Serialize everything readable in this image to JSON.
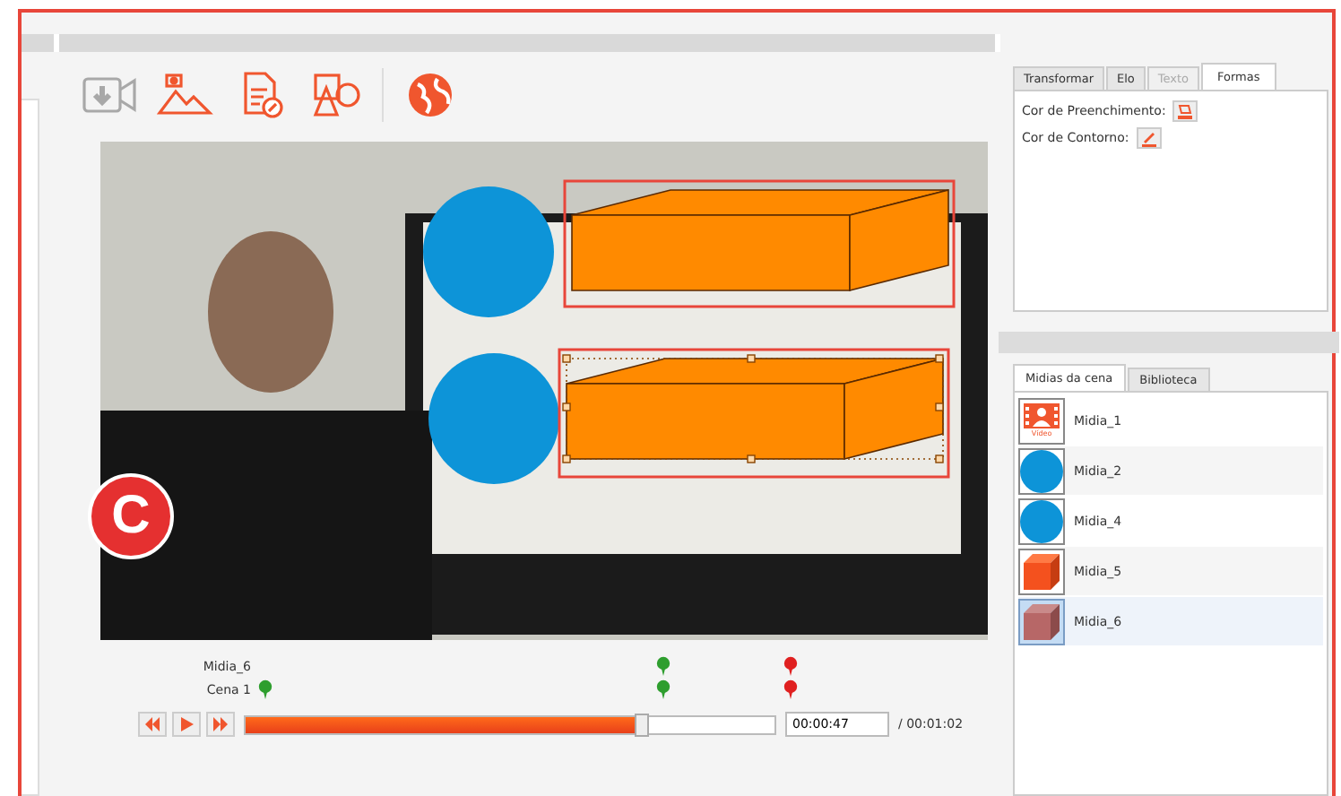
{
  "badge": {
    "text": "C"
  },
  "toolbar": [
    {
      "kind": "video",
      "disabled": true
    },
    {
      "kind": "image",
      "disabled": false
    },
    {
      "kind": "document",
      "disabled": false
    },
    {
      "kind": "shapes",
      "disabled": false
    },
    {
      "kind": "globe",
      "disabled": false
    }
  ],
  "scene": {
    "shapes": [
      {
        "kind": "circle",
        "selected": false
      },
      {
        "kind": "box",
        "selected": false
      },
      {
        "kind": "circle",
        "selected": false
      },
      {
        "kind": "box",
        "selected": true
      }
    ]
  },
  "timeline": {
    "tracks": [
      {
        "label": "Midia_6",
        "markers": [
          {
            "kind": "current",
            "color": "#2e9e2e"
          },
          {
            "kind": "end",
            "color": "#e02020"
          }
        ]
      },
      {
        "label": "Cena 1",
        "markers": [
          {
            "kind": "start",
            "color": "#2e9e2e"
          },
          {
            "kind": "current",
            "color": "#2e9e2e"
          },
          {
            "kind": "end",
            "color": "#e02020"
          }
        ]
      }
    ],
    "controls": [
      {
        "kind": "rewind"
      },
      {
        "kind": "play"
      },
      {
        "kind": "forward"
      }
    ],
    "level": 0.75,
    "time": "00:00:47",
    "total": "/ 00:01:02"
  },
  "properties": {
    "tabs": [
      {
        "label": "Transformar",
        "selected": false,
        "disabled": false
      },
      {
        "label": "Elo",
        "selected": false,
        "disabled": false
      },
      {
        "label": "Texto",
        "selected": false,
        "disabled": true
      },
      {
        "label": "Formas",
        "selected": true,
        "disabled": false
      }
    ],
    "fields": [
      {
        "label": "Cor de Preenchimento:",
        "kind": "fill"
      },
      {
        "label": "Cor de Contorno:",
        "kind": "stroke"
      }
    ]
  },
  "media": {
    "tabs": [
      {
        "label": "Midias da cena",
        "selected": true
      },
      {
        "label": "Biblioteca",
        "selected": false
      }
    ],
    "items": [
      {
        "name": "Midia_1",
        "kind": "video",
        "thumb_label": "Vídeo",
        "selected": false
      },
      {
        "name": "Midia_2",
        "kind": "circle",
        "selected": false
      },
      {
        "name": "Midia_4",
        "kind": "circle",
        "selected": false
      },
      {
        "name": "Midia_5",
        "kind": "cube",
        "selected": false
      },
      {
        "name": "Midia_6",
        "kind": "cube-muted",
        "selected": true
      }
    ]
  }
}
